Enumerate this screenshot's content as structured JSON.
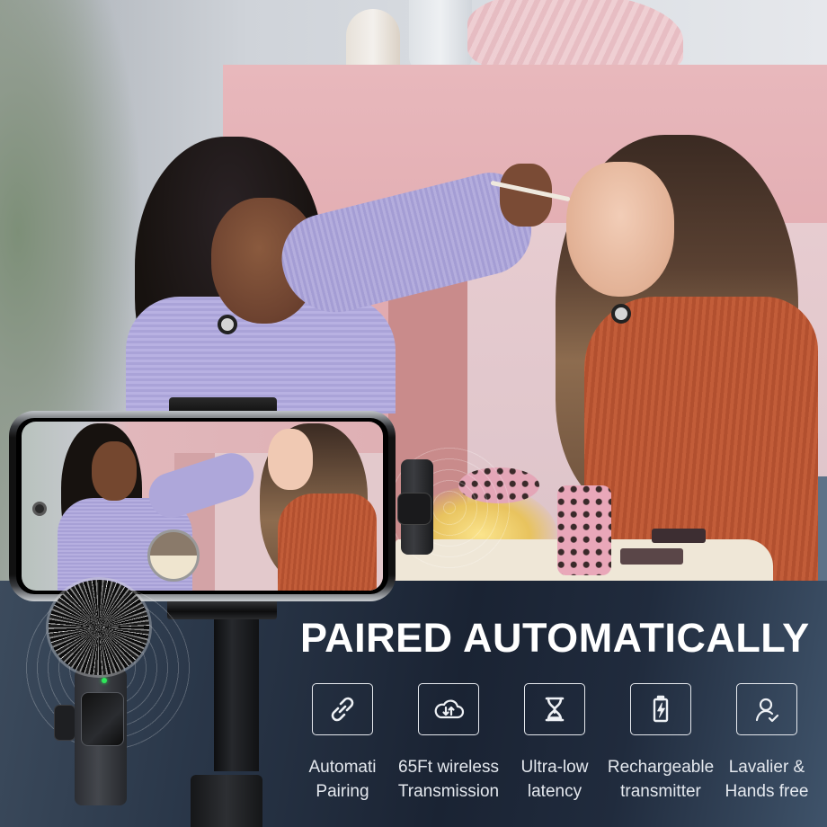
{
  "headline": "PAIRED AUTOMATICALLY",
  "features": [
    {
      "icon": "link-icon",
      "line1": "Automati",
      "line2": "Pairing"
    },
    {
      "icon": "cloud-transfer-icon",
      "line1": "65Ft wireless",
      "line2": "Transmission"
    },
    {
      "icon": "hourglass-icon",
      "line1": "Ultra-low",
      "line2": "latency"
    },
    {
      "icon": "battery-charging-icon",
      "line1": "Rechargeable",
      "line2": "transmitter"
    },
    {
      "icon": "user-check-icon",
      "line1": "Lavalier &",
      "line2": "Hands free"
    }
  ],
  "colors": {
    "panel_dark": "#1a2333",
    "text_primary": "#ffffff",
    "text_secondary": "#e4e8ee",
    "led_green": "#2ee85a",
    "wall_pink": "#e2acb1"
  },
  "scene": {
    "description": "Two women doing makeup, recorded on a smartphone on a stand with wireless lavalier microphones"
  }
}
